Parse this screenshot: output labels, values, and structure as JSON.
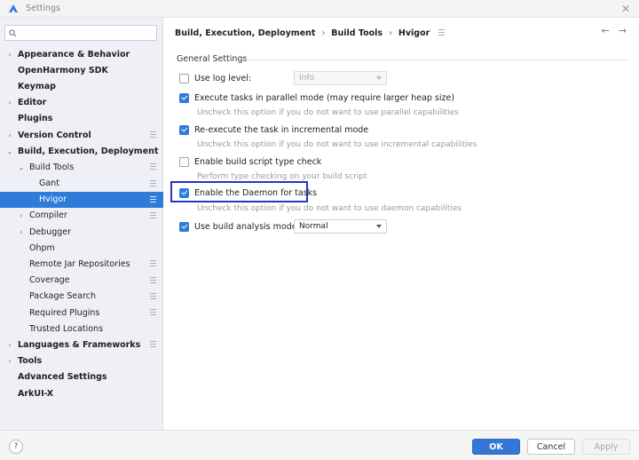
{
  "window": {
    "title": "Settings"
  },
  "search": {
    "placeholder": ""
  },
  "sidebar": {
    "items": [
      {
        "label": "Appearance & Behavior",
        "level": 0,
        "arrow": "›",
        "bold": true,
        "settings_icon": false,
        "selected": false
      },
      {
        "label": "OpenHarmony SDK",
        "level": 0,
        "arrow": "",
        "bold": true,
        "settings_icon": false,
        "selected": false
      },
      {
        "label": "Keymap",
        "level": 0,
        "arrow": "",
        "bold": true,
        "settings_icon": false,
        "selected": false
      },
      {
        "label": "Editor",
        "level": 0,
        "arrow": "›",
        "bold": true,
        "settings_icon": false,
        "selected": false
      },
      {
        "label": "Plugins",
        "level": 0,
        "arrow": "",
        "bold": true,
        "settings_icon": false,
        "selected": false
      },
      {
        "label": "Version Control",
        "level": 0,
        "arrow": "›",
        "bold": true,
        "settings_icon": true,
        "selected": false
      },
      {
        "label": "Build, Execution, Deployment",
        "level": 0,
        "arrow": "⌄",
        "bold": true,
        "settings_icon": false,
        "selected": false
      },
      {
        "label": "Build Tools",
        "level": 1,
        "arrow": "⌄",
        "bold": false,
        "settings_icon": true,
        "selected": false
      },
      {
        "label": "Gant",
        "level": 2,
        "arrow": "",
        "bold": false,
        "settings_icon": true,
        "selected": false
      },
      {
        "label": "Hvigor",
        "level": 2,
        "arrow": "",
        "bold": false,
        "settings_icon": true,
        "selected": true
      },
      {
        "label": "Compiler",
        "level": 1,
        "arrow": "›",
        "bold": false,
        "settings_icon": true,
        "selected": false
      },
      {
        "label": "Debugger",
        "level": 1,
        "arrow": "›",
        "bold": false,
        "settings_icon": false,
        "selected": false
      },
      {
        "label": "Ohpm",
        "level": 1,
        "arrow": "",
        "bold": false,
        "settings_icon": false,
        "selected": false
      },
      {
        "label": "Remote Jar Repositories",
        "level": 1,
        "arrow": "",
        "bold": false,
        "settings_icon": true,
        "selected": false
      },
      {
        "label": "Coverage",
        "level": 1,
        "arrow": "",
        "bold": false,
        "settings_icon": true,
        "selected": false
      },
      {
        "label": "Package Search",
        "level": 1,
        "arrow": "",
        "bold": false,
        "settings_icon": true,
        "selected": false
      },
      {
        "label": "Required Plugins",
        "level": 1,
        "arrow": "",
        "bold": false,
        "settings_icon": true,
        "selected": false
      },
      {
        "label": "Trusted Locations",
        "level": 1,
        "arrow": "",
        "bold": false,
        "settings_icon": false,
        "selected": false
      },
      {
        "label": "Languages & Frameworks",
        "level": 0,
        "arrow": "›",
        "bold": true,
        "settings_icon": true,
        "selected": false
      },
      {
        "label": "Tools",
        "level": 0,
        "arrow": "›",
        "bold": true,
        "settings_icon": false,
        "selected": false
      },
      {
        "label": "Advanced Settings",
        "level": 0,
        "arrow": "",
        "bold": true,
        "settings_icon": false,
        "selected": false
      },
      {
        "label": "ArkUI-X",
        "level": 0,
        "arrow": "",
        "bold": true,
        "settings_icon": false,
        "selected": false
      }
    ]
  },
  "breadcrumb": {
    "items": [
      "Build, Execution, Deployment",
      "Build Tools",
      "Hvigor"
    ],
    "separator": "›"
  },
  "nav": {
    "back": "←",
    "forward": "→"
  },
  "general": {
    "title": "General Settings",
    "use_log_level": {
      "label": "Use log level:",
      "checked": false,
      "value": "Info"
    },
    "parallel": {
      "label": "Execute tasks in parallel mode (may require larger heap size)",
      "checked": true,
      "hint": "Uncheck this option if you do not want to use parallel capabilities"
    },
    "incremental": {
      "label": "Re-execute the task in incremental mode",
      "checked": true,
      "hint": "Uncheck this option if you do not want to use incremental capabilities"
    },
    "type_check": {
      "label": "Enable build script type check",
      "checked": false,
      "hint": "Perform type checking on your build script"
    },
    "daemon": {
      "label": "Enable the Daemon for tasks",
      "checked": true,
      "hint": "Uncheck this option if you do not want to use daemon capabilities"
    },
    "analysis": {
      "label": "Use build analysis mode:",
      "checked": true,
      "value": "Normal"
    }
  },
  "buttons": {
    "help": "?",
    "ok": "OK",
    "cancel": "Cancel",
    "apply": "Apply"
  },
  "colors": {
    "accent": "#2f7bd9",
    "highlight_border": "#2733c9",
    "sidebar_bg": "#eef0f5"
  }
}
